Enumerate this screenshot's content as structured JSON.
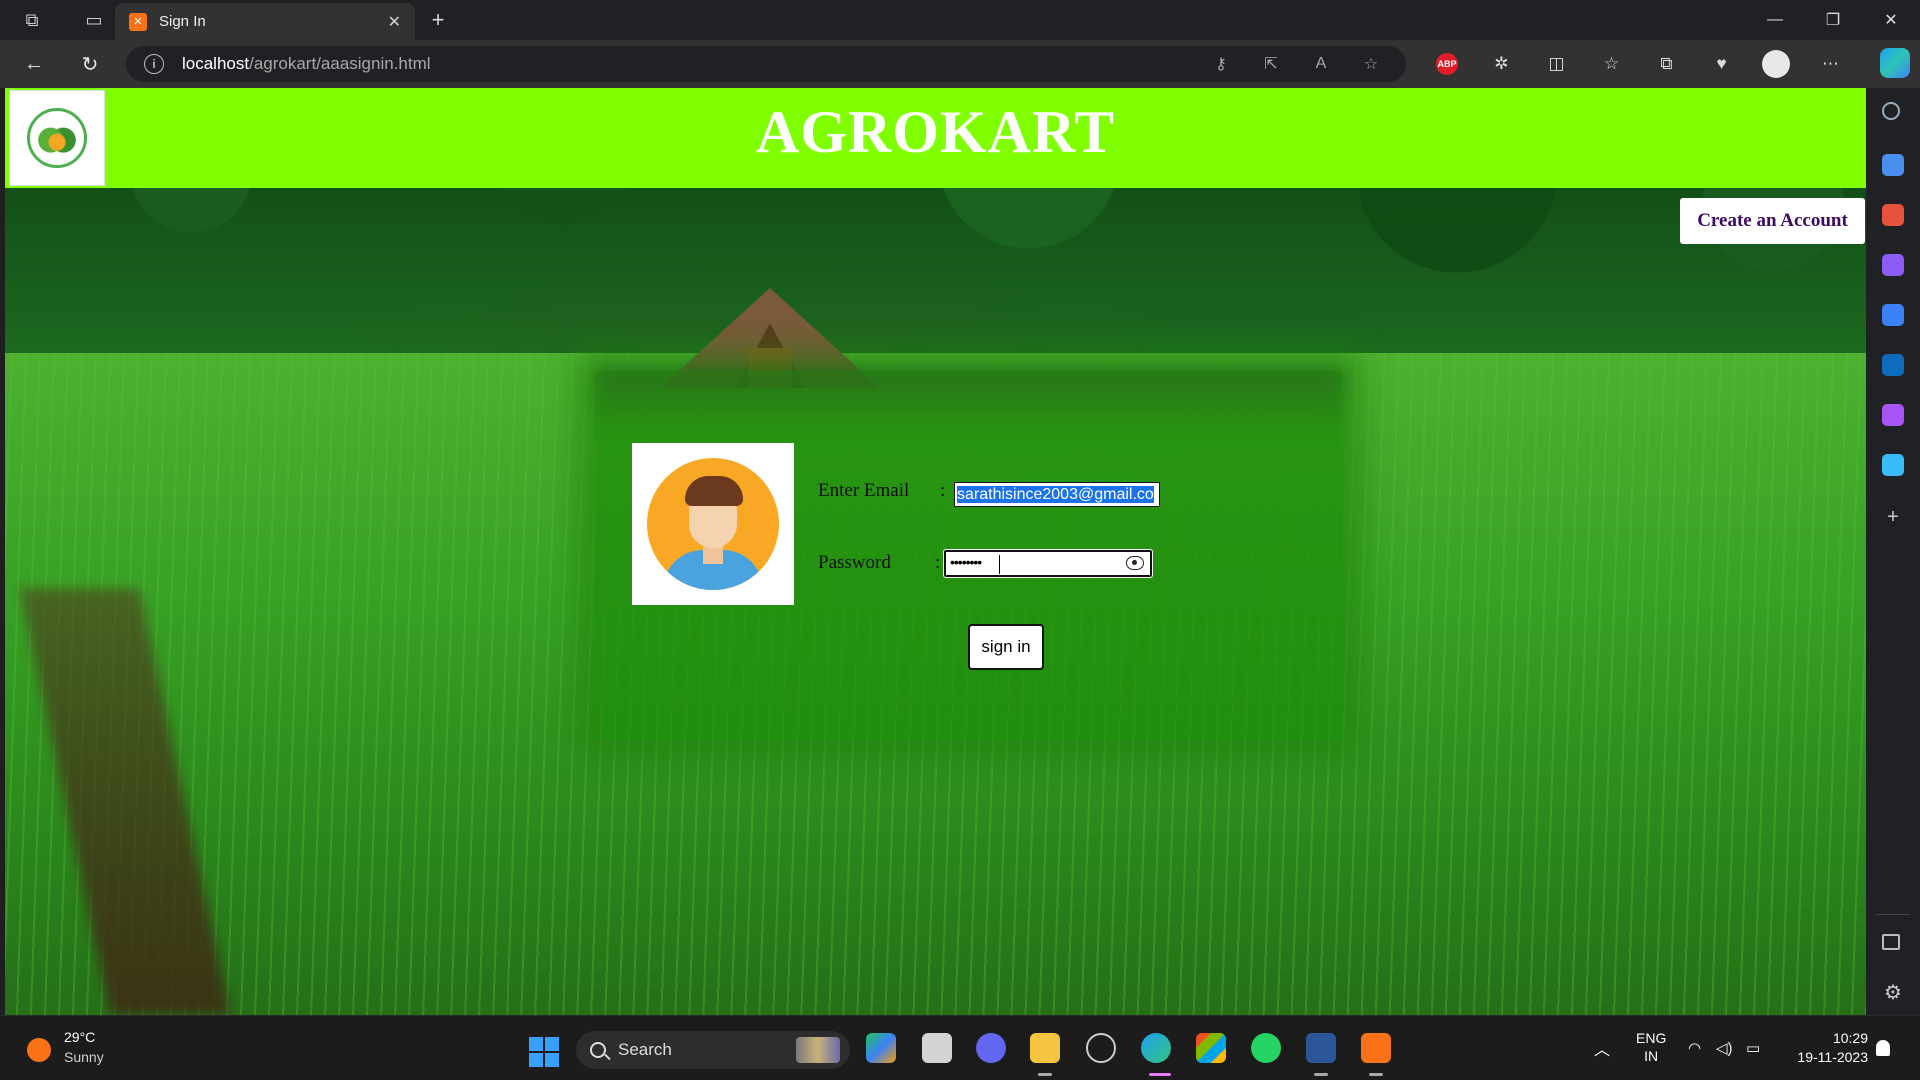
{
  "browser": {
    "tab_title": "Sign In",
    "url_host": "localhost",
    "url_path": "/agrokart/aaasignin.html"
  },
  "page": {
    "brand": "AGROKART",
    "create_account": "Create an Account",
    "form": {
      "email_label": "Enter Email",
      "email_value": "sarathisince2003@gmail.co",
      "password_label": "Password",
      "password_mask": "••••••••",
      "colon": ":",
      "signin_label": "sign in"
    }
  },
  "taskbar": {
    "temperature": "29°C",
    "weather": "Sunny",
    "search_label": "Search",
    "lang_1": "ENG",
    "lang_2": "IN",
    "time": "10:29",
    "date": "19-11-2023"
  },
  "colors": {
    "header_green": "#80ff00",
    "create_text": "#3c0a63",
    "panel_green": "#1e8c0a"
  }
}
